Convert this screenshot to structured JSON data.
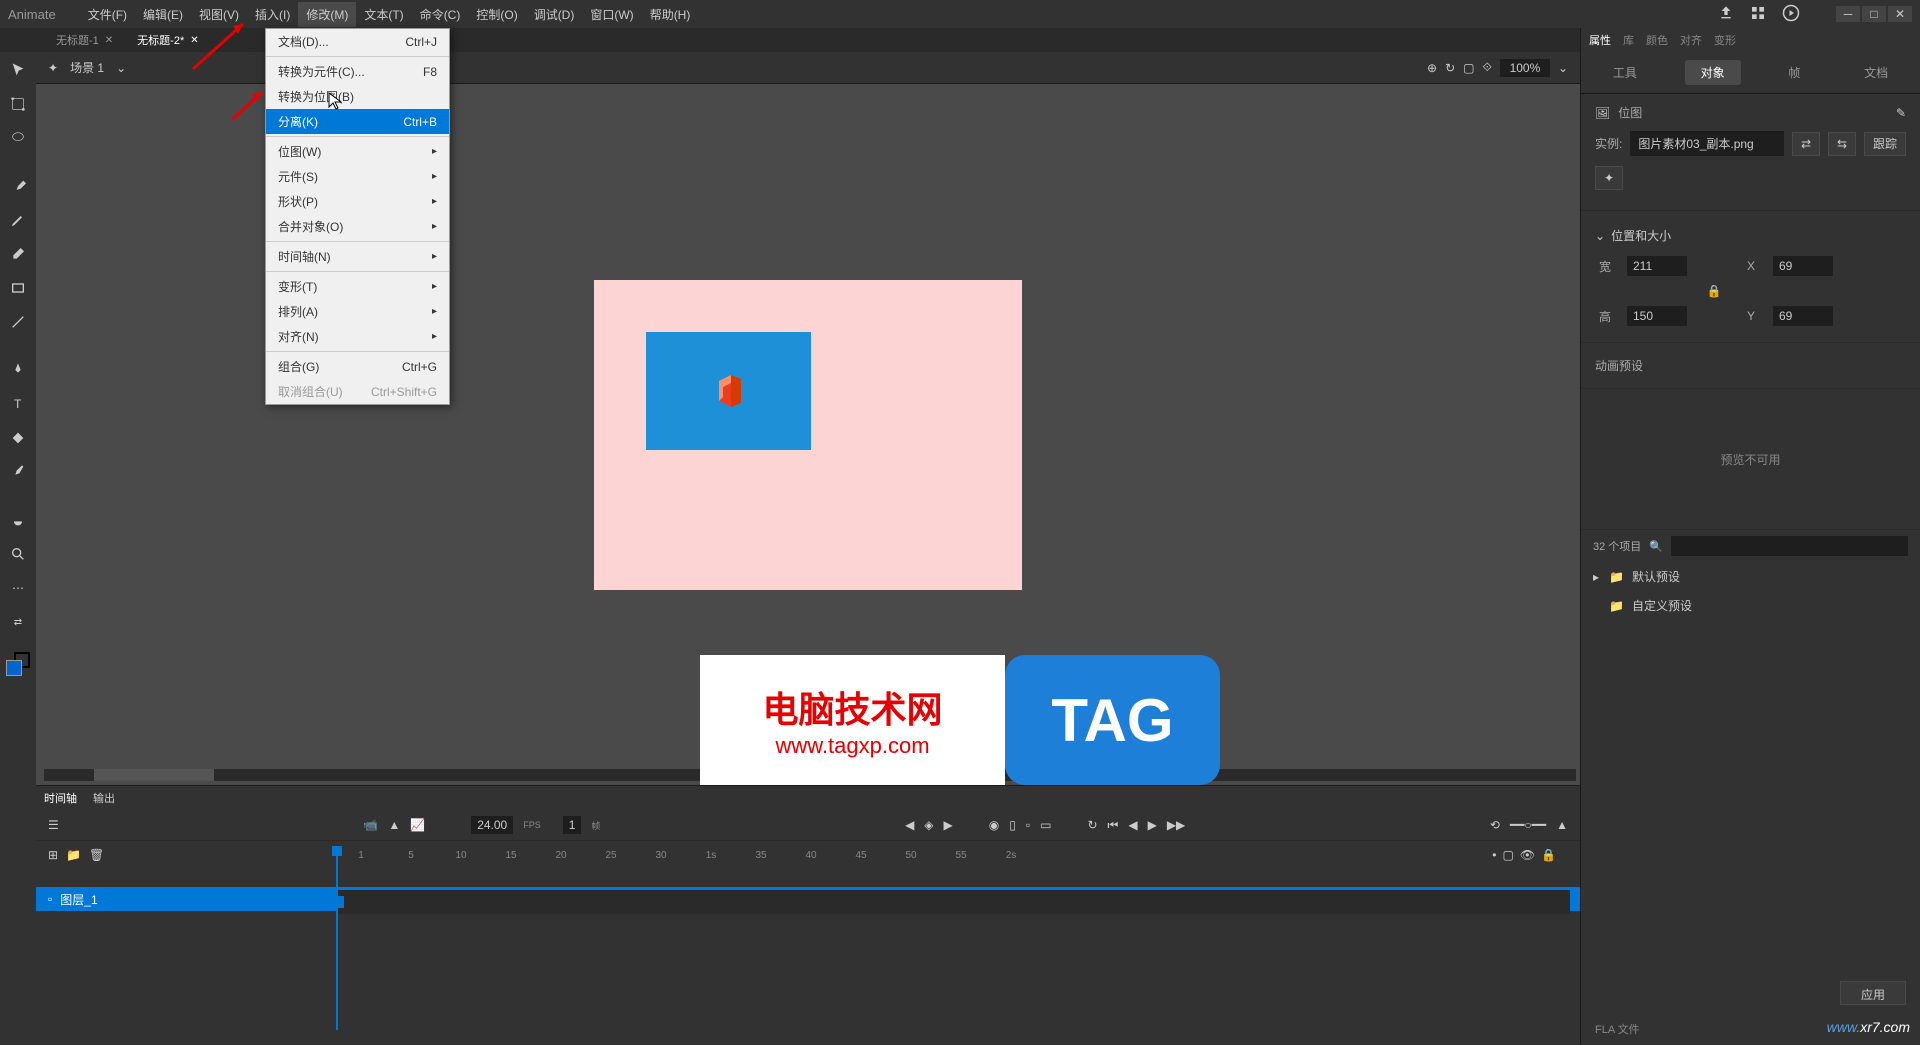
{
  "app": {
    "name": "Animate"
  },
  "menubar": {
    "items": [
      "文件(F)",
      "编辑(E)",
      "视图(V)",
      "插入(I)",
      "修改(M)",
      "文本(T)",
      "命令(C)",
      "控制(O)",
      "调试(D)",
      "窗口(W)",
      "帮助(H)"
    ]
  },
  "dropdown": {
    "items": [
      {
        "label": "文档(D)...",
        "shortcut": "Ctrl+J"
      },
      {
        "sep": true
      },
      {
        "label": "转换为元件(C)...",
        "shortcut": "F8"
      },
      {
        "label": "转换为位图(B)"
      },
      {
        "label": "分离(K)",
        "shortcut": "Ctrl+B",
        "highlighted": true
      },
      {
        "sep": true
      },
      {
        "label": "位图(W)",
        "submenu": true
      },
      {
        "label": "元件(S)",
        "submenu": true
      },
      {
        "label": "形状(P)",
        "submenu": true
      },
      {
        "label": "合并对象(O)",
        "submenu": true
      },
      {
        "sep": true
      },
      {
        "label": "时间轴(N)",
        "submenu": true
      },
      {
        "sep": true
      },
      {
        "label": "变形(T)",
        "submenu": true
      },
      {
        "label": "排列(A)",
        "submenu": true
      },
      {
        "label": "对齐(N)",
        "submenu": true
      },
      {
        "sep": true
      },
      {
        "label": "组合(G)",
        "shortcut": "Ctrl+G"
      },
      {
        "label": "取消组合(U)",
        "shortcut": "Ctrl+Shift+G",
        "disabled": true
      }
    ]
  },
  "tabs": [
    {
      "label": "无标题-1",
      "active": false
    },
    {
      "label": "无标题-2*",
      "active": true
    }
  ],
  "scene": {
    "label": "场景 1",
    "zoom": "100%"
  },
  "right_panel": {
    "small_tabs": [
      "属性",
      "库",
      "颜色",
      "对齐",
      "变形"
    ],
    "big_tabs": [
      "工具",
      "对象",
      "帧",
      "文档"
    ],
    "active_big": "对象",
    "type_label": "位图",
    "instance_label": "实例:",
    "instance_value": "图片素材03_副本.png",
    "track_btn": "跟踪",
    "pos_section": "位置和大小",
    "width_label": "宽",
    "width_val": "211",
    "height_label": "高",
    "height_val": "150",
    "x_label": "X",
    "x_val": "69",
    "y_label": "Y",
    "y_val": "69",
    "preview_section": "动画预设",
    "preview_empty": "预览不可用",
    "item_count": "32 个项目",
    "presets": [
      {
        "label": "默认预设",
        "expandable": true
      },
      {
        "label": "自定义预设",
        "expandable": false
      }
    ],
    "apply_btn": "应用",
    "fla_hint": "FLA 文件"
  },
  "timeline": {
    "tabs": [
      "时间轴",
      "输出"
    ],
    "fps": "24.00",
    "fps_label": "FPS",
    "frame": "1",
    "frame_label": "帧",
    "ruler": [
      "1",
      "5",
      "10",
      "15",
      "20",
      "25",
      "30",
      "1s",
      "35",
      "40",
      "45",
      "50",
      "55",
      "2s"
    ],
    "layer_name": "图层_1"
  },
  "watermark": {
    "text1": "电脑技术网",
    "url1": "www.tagxp.com",
    "text2": "TAG",
    "text3_prefix": "www.",
    "text3_suffix": "xr7.com"
  }
}
